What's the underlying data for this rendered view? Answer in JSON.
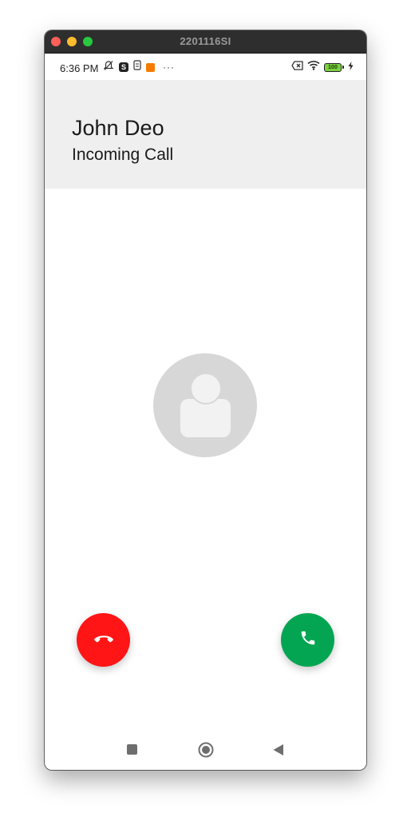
{
  "window": {
    "title": "2201116SI"
  },
  "statusbar": {
    "time": "6:36 PM",
    "s_badge": "S",
    "more": "···",
    "battery_level": "100"
  },
  "call": {
    "caller_name": "John Deo",
    "status": "Incoming Call",
    "decline_color": "#ff1515",
    "accept_color": "#03a552"
  },
  "icons": {
    "decline": "phone-hangup-icon",
    "accept": "phone-icon",
    "avatar": "person-icon",
    "nav": [
      "recents-square-icon",
      "home-circle-icon",
      "back-triangle-icon"
    ]
  }
}
